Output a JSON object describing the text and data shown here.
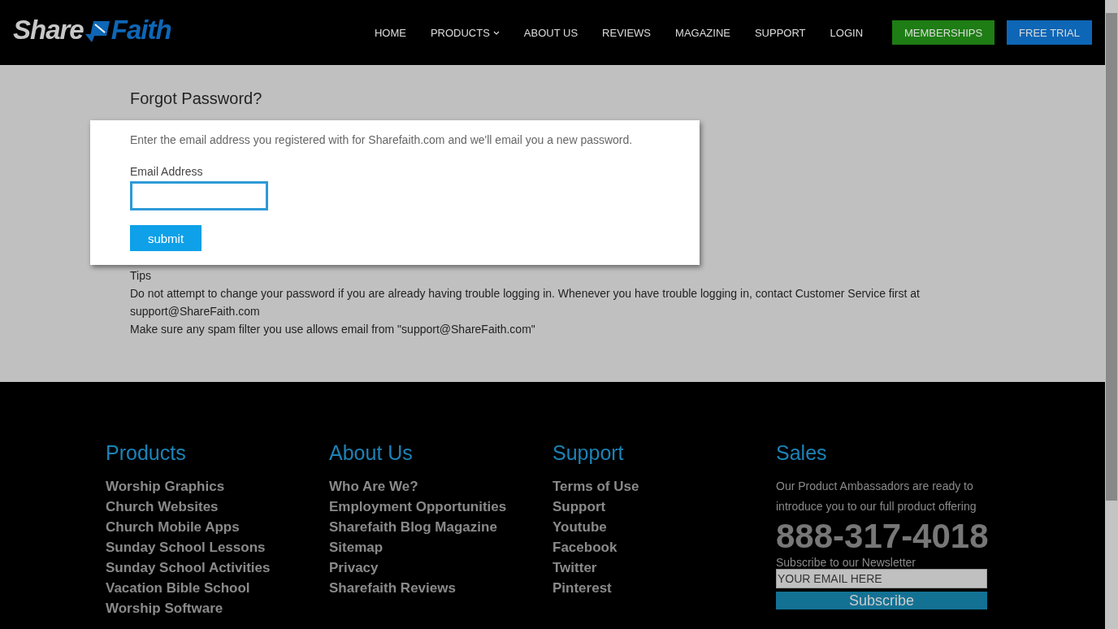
{
  "header": {
    "logo": {
      "left": "Share",
      "right": "Faith"
    },
    "nav": [
      {
        "label": "HOME",
        "has_menu": false
      },
      {
        "label": "PRODUCTS",
        "has_menu": true
      },
      {
        "label": "ABOUT US",
        "has_menu": false
      },
      {
        "label": "REVIEWS",
        "has_menu": false
      },
      {
        "label": "MAGAZINE",
        "has_menu": false
      },
      {
        "label": "SUPPORT",
        "has_menu": false
      },
      {
        "label": "LOGIN",
        "has_menu": false
      }
    ],
    "buttons": [
      {
        "label": "MEMBERSHIPS",
        "color": "#1e7d14"
      },
      {
        "label": "FREE TRIAL",
        "color": "#0e66b6"
      }
    ]
  },
  "main": {
    "title": "Forgot Password?",
    "card": {
      "intro": "Enter the email address you registered with for Sharefaith.com and we'll email you a new password.",
      "field_label": "Email Address",
      "submit": "submit"
    },
    "tips_heading": "Tips",
    "tips": [
      "Do not attempt to change your password if you are already having trouble logging in. Whenever you have trouble logging in, contact Customer Service first at support@ShareFaith.com",
      "Make sure any spam filter you use allows email from \"support@ShareFaith.com\""
    ]
  },
  "footer": {
    "columns": [
      {
        "heading": "Products",
        "links": [
          "Worship Graphics",
          "Church Websites",
          "Church Mobile Apps",
          "Sunday School Lessons",
          "Sunday School Activities",
          "Vacation Bible School",
          "Worship Software"
        ]
      },
      {
        "heading": "About Us",
        "links": [
          "Who Are We?",
          "Employment Opportunities",
          "Sharefaith Blog Magazine",
          "Sitemap",
          "Privacy",
          "Sharefaith Reviews"
        ]
      },
      {
        "heading": "Support",
        "links": [
          "Terms of Use",
          "Support",
          "Youtube",
          "Facebook",
          "Twitter",
          "Pinterest"
        ]
      }
    ],
    "sales": {
      "heading": "Sales",
      "text": "Our Product Ambassadors are ready to introduce you to our full product offering",
      "phone": "888-317-4018",
      "newsletter_label": "Subscribe to our Newsletter",
      "newsletter_value": "YOUR EMAIL HERE",
      "subscribe": "Subscribe"
    }
  }
}
